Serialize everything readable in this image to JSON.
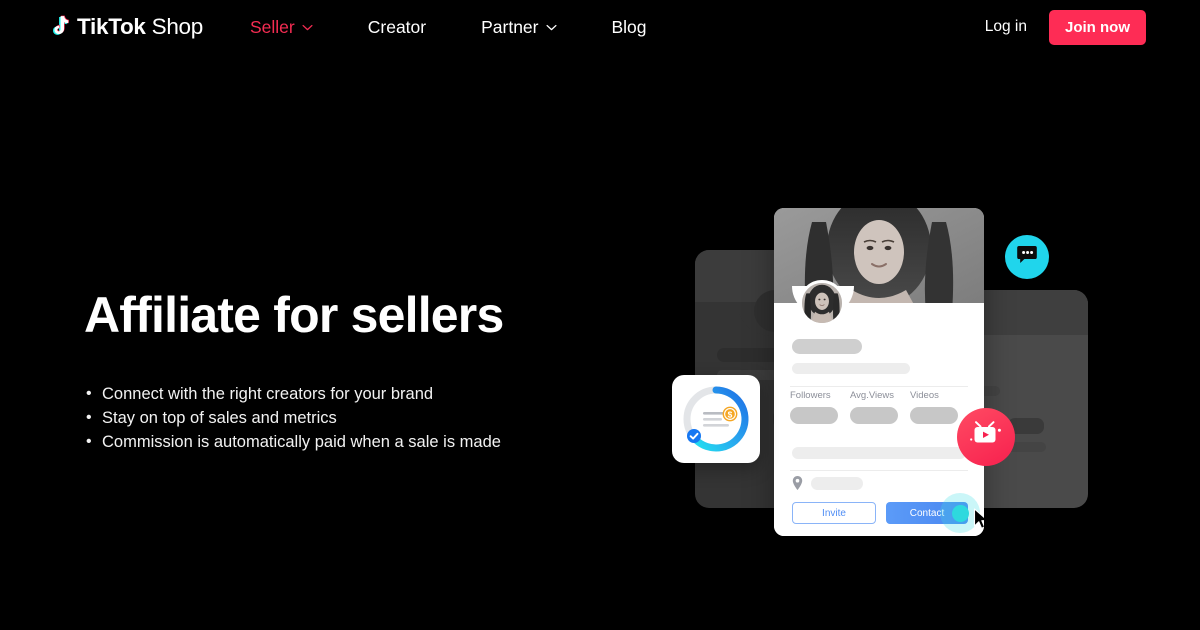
{
  "brand": {
    "logo_icon": "tiktok-note-icon",
    "name_bold": "TikTok",
    "name_light": "Shop"
  },
  "nav": {
    "items": [
      {
        "label": "Seller",
        "has_dropdown": true,
        "active": true,
        "icon": "chevron-down-icon"
      },
      {
        "label": "Creator",
        "has_dropdown": false,
        "active": false,
        "icon": ""
      },
      {
        "label": "Partner",
        "has_dropdown": true,
        "active": false,
        "icon": "chevron-down-icon"
      },
      {
        "label": "Blog",
        "has_dropdown": false,
        "active": false,
        "icon": ""
      }
    ],
    "login_label": "Log in",
    "join_label": "Join now",
    "active_color": "#f42c52",
    "join_bg": "#fe2c55"
  },
  "hero": {
    "title": "Affiliate for sellers",
    "bullets": [
      "Connect with the right creators for your brand",
      "Stay on top of sales and metrics",
      "Commission is automatically paid when a sale is made"
    ]
  },
  "illustration": {
    "profile_card": {
      "stats": [
        {
          "label": "Followers"
        },
        {
          "label": "Avg.Views"
        },
        {
          "label": "Videos"
        }
      ],
      "location_icon": "map-pin-icon",
      "invite_label": "Invite",
      "contact_label": "Contact",
      "contact_bg": "#4a86f0",
      "invite_border": "#8ab4f8",
      "cursor_icon": "mouse-pointer-icon",
      "avatar_icon": "creator-avatar"
    },
    "badges": [
      {
        "name": "chat-bubble-badge",
        "icon": "chat-bubble-icon",
        "color": "#20d5ec"
      },
      {
        "name": "video-play-badge",
        "icon": "tv-play-icon",
        "color": "#f7204e"
      }
    ],
    "donut_widget": {
      "icon": "donut-chart-icon",
      "coin_icon": "dollar-coin-icon",
      "check_icon": "check-badge-icon",
      "track_color": "#e3e5e8",
      "arc_start": "#1f6fe5",
      "arc_end": "#22e0f0",
      "coin_color": "#f5a623",
      "check_color": "#1677f2"
    }
  }
}
